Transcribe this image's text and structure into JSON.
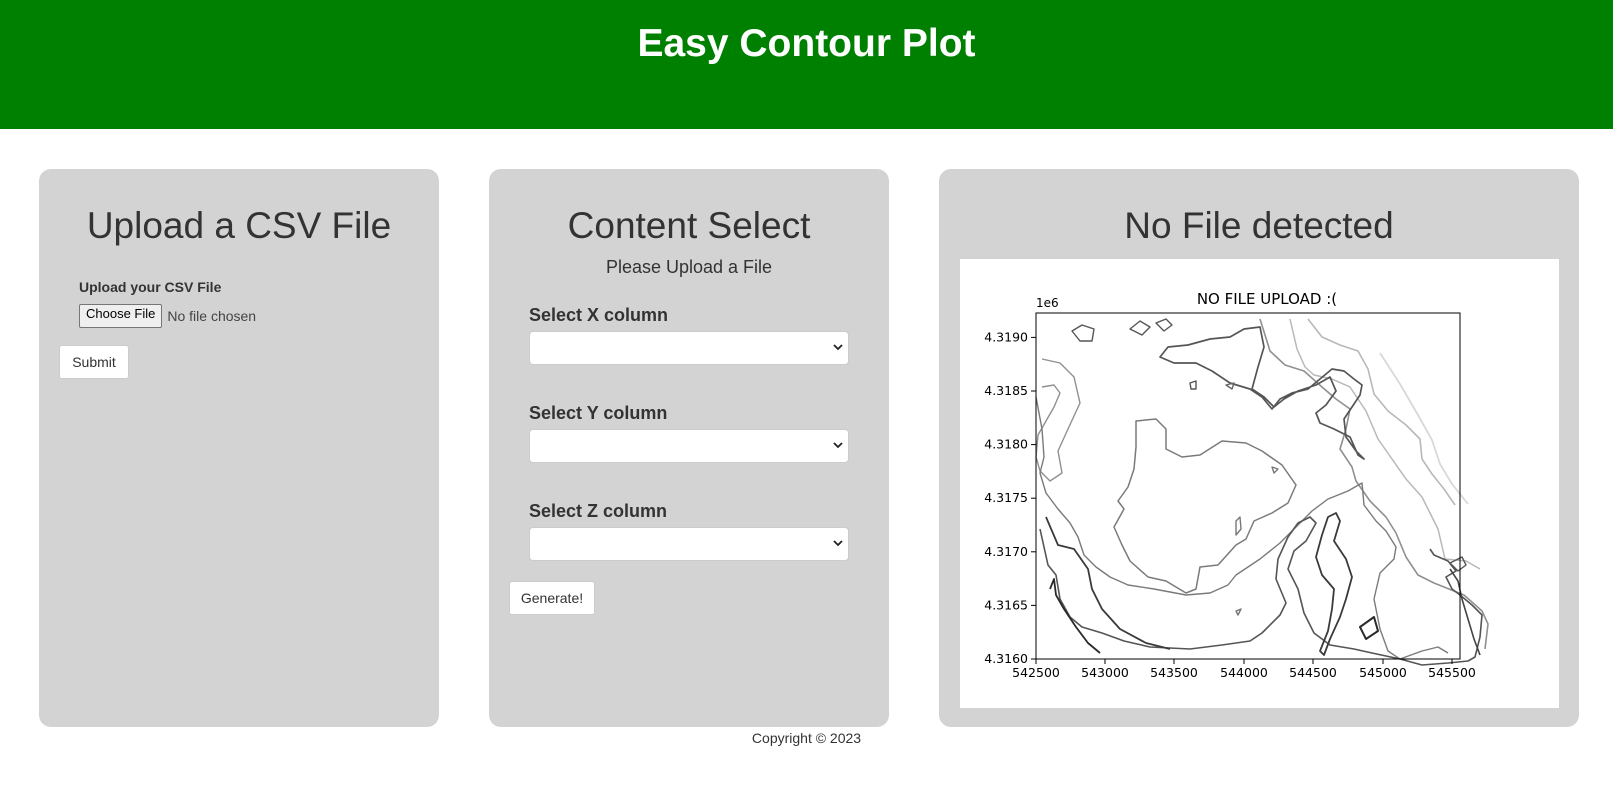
{
  "header": {
    "title": "Easy Contour Plot",
    "color": "#008000"
  },
  "upload_panel": {
    "title": "Upload a CSV File",
    "field_label": "Upload your CSV File",
    "file_button": "Choose File",
    "file_status": "No file chosen",
    "submit_label": "Submit"
  },
  "select_panel": {
    "title": "Content Select",
    "subtitle": "Please Upload a File",
    "x_label": "Select X column",
    "y_label": "Select Y column",
    "z_label": "Select Z column",
    "x_value": "",
    "y_value": "",
    "z_value": "",
    "generate_label": "Generate!"
  },
  "plot_panel": {
    "title": "No File detected",
    "plot": {
      "title": "NO FILE UPLOAD :(",
      "offset_text": "1e6",
      "x_ticks": [
        "542500",
        "543000",
        "543500",
        "544000",
        "544500",
        "545000",
        "545500"
      ],
      "y_ticks": [
        "4.3160",
        "4.3165",
        "4.3170",
        "4.3175",
        "4.3180",
        "4.3185",
        "4.3190"
      ]
    }
  },
  "chart_data": {
    "type": "contour",
    "title": "NO FILE UPLOAD :(",
    "xlabel": "",
    "ylabel": "",
    "xlim": [
      542480,
      545820
    ],
    "ylim": [
      4316000,
      4316215
    ],
    "x_ticks": [
      542500,
      543000,
      543500,
      544000,
      544500,
      545000,
      545500
    ],
    "y_ticks": [
      4.316,
      4.3165,
      4.317,
      4.3175,
      4.318,
      4.3185,
      4.319
    ],
    "y_scale_factor": "1e6",
    "grid": false,
    "colormap": "greys"
  },
  "footer": {
    "text": "Copyright © 2023"
  }
}
